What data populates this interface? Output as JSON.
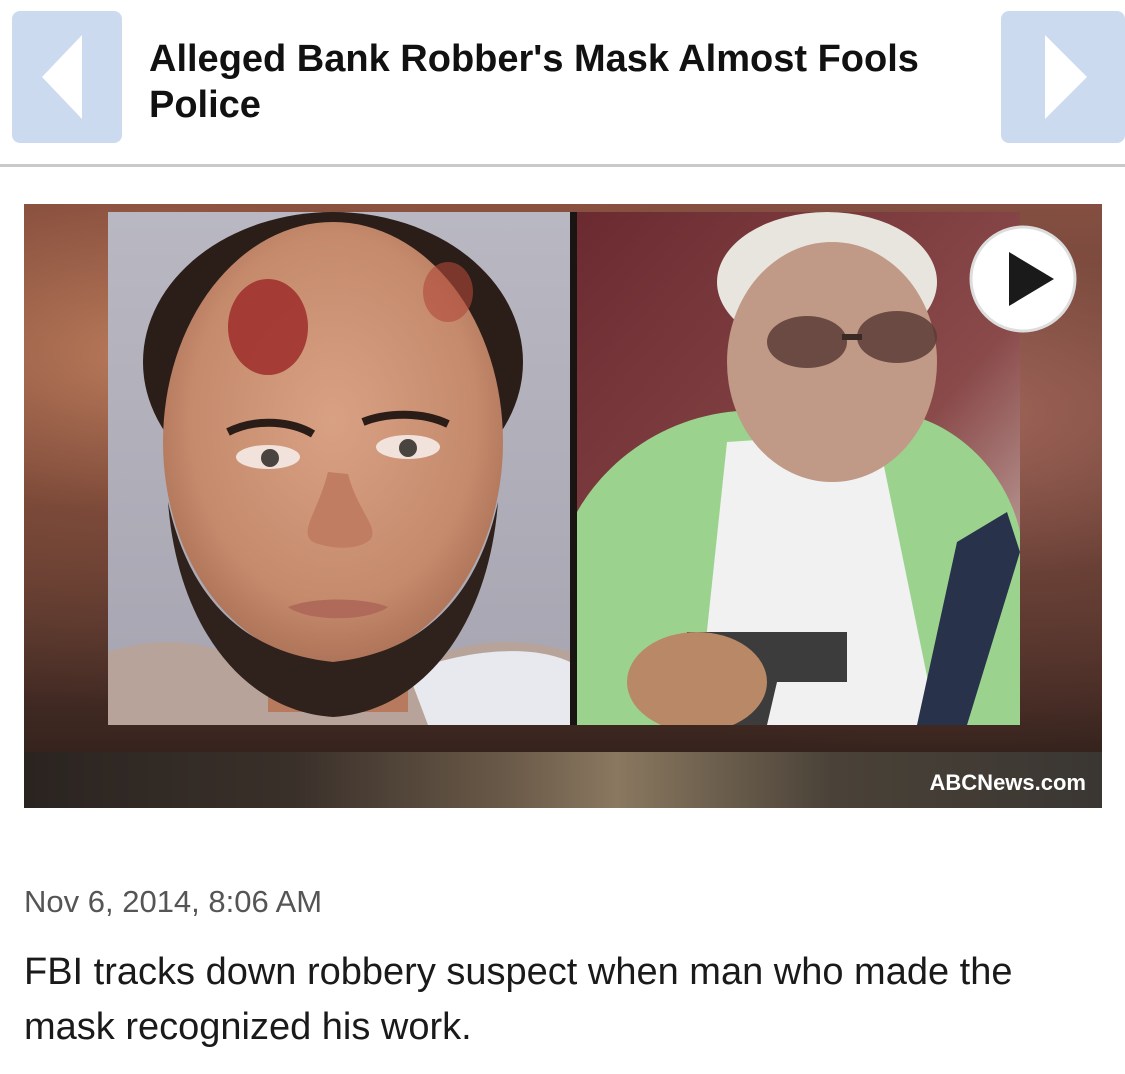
{
  "article": {
    "headline": "Alleged Bank Robber's Mask Almost Fools Police",
    "image_source": "ABCNews.com",
    "dateline": "Nov 6, 2014, 8:06 AM",
    "summary": "FBI tracks down robbery suspect when man who made the mask recognized his work."
  },
  "icons": {
    "prev": "chevron-left-icon",
    "next": "chevron-right-icon",
    "play": "play-icon"
  },
  "colors": {
    "nav_button": "#cbdaee",
    "header_rule": "#c9c9c9",
    "headline_text": "#111111",
    "dateline_text": "#555555"
  }
}
